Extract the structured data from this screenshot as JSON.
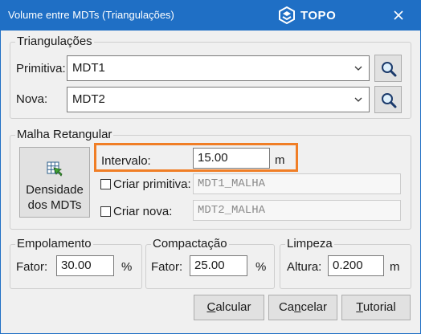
{
  "window": {
    "title": "Volume entre MDTs (Triangulações)",
    "brand": "TOPO",
    "close_icon": "close-icon"
  },
  "triangulacoes": {
    "legend": "Triangulações",
    "primitiva_label": "Primitiva:",
    "primitiva_value": "MDT1",
    "nova_label": "Nova:",
    "nova_value": "MDT2"
  },
  "malha": {
    "legend": "Malha Retangular",
    "densidade_line1": "Densidade",
    "densidade_line2": "dos MDTs",
    "intervalo_label": "Intervalo:",
    "intervalo_value": "15.00",
    "intervalo_unit": "m",
    "criar_primitiva_label": "Criar primitiva:",
    "criar_primitiva_value": "MDT1_MALHA",
    "criar_primitiva_checked": false,
    "criar_nova_label": "Criar nova:",
    "criar_nova_value": "MDT2_MALHA",
    "criar_nova_checked": false
  },
  "empolamento": {
    "legend": "Empolamento",
    "label": "Fator:",
    "value": "30.00",
    "unit": "%"
  },
  "compactacao": {
    "legend": "Compactação",
    "label": "Fator:",
    "value": "25.00",
    "unit": "%"
  },
  "limpeza": {
    "legend": "Limpeza",
    "label": "Altura:",
    "value": "0.200",
    "unit": "m"
  },
  "buttons": {
    "calcular": {
      "pre": "",
      "mn": "C",
      "post": "alcular"
    },
    "cancelar": {
      "pre": "Ca",
      "mn": "n",
      "post": "celar"
    },
    "tutorial": {
      "pre": "",
      "mn": "T",
      "post": "utorial"
    }
  },
  "colors": {
    "titlebar": "#1f6fc5",
    "highlight": "#f07e26",
    "dialog_bg": "#f0f0f0"
  }
}
